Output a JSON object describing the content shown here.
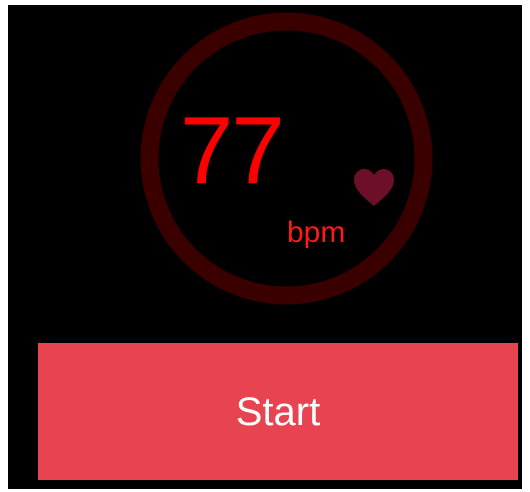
{
  "heart_rate": {
    "value": "77",
    "unit": "bpm"
  },
  "icons": {
    "heart": "heart-icon"
  },
  "colors": {
    "background": "#000000",
    "ring": "#3a0000",
    "value_text": "#ff0000",
    "heart": "#6e0f2a",
    "button": "#e84350",
    "button_text": "#ffffff"
  },
  "controls": {
    "start_label": "Start"
  }
}
